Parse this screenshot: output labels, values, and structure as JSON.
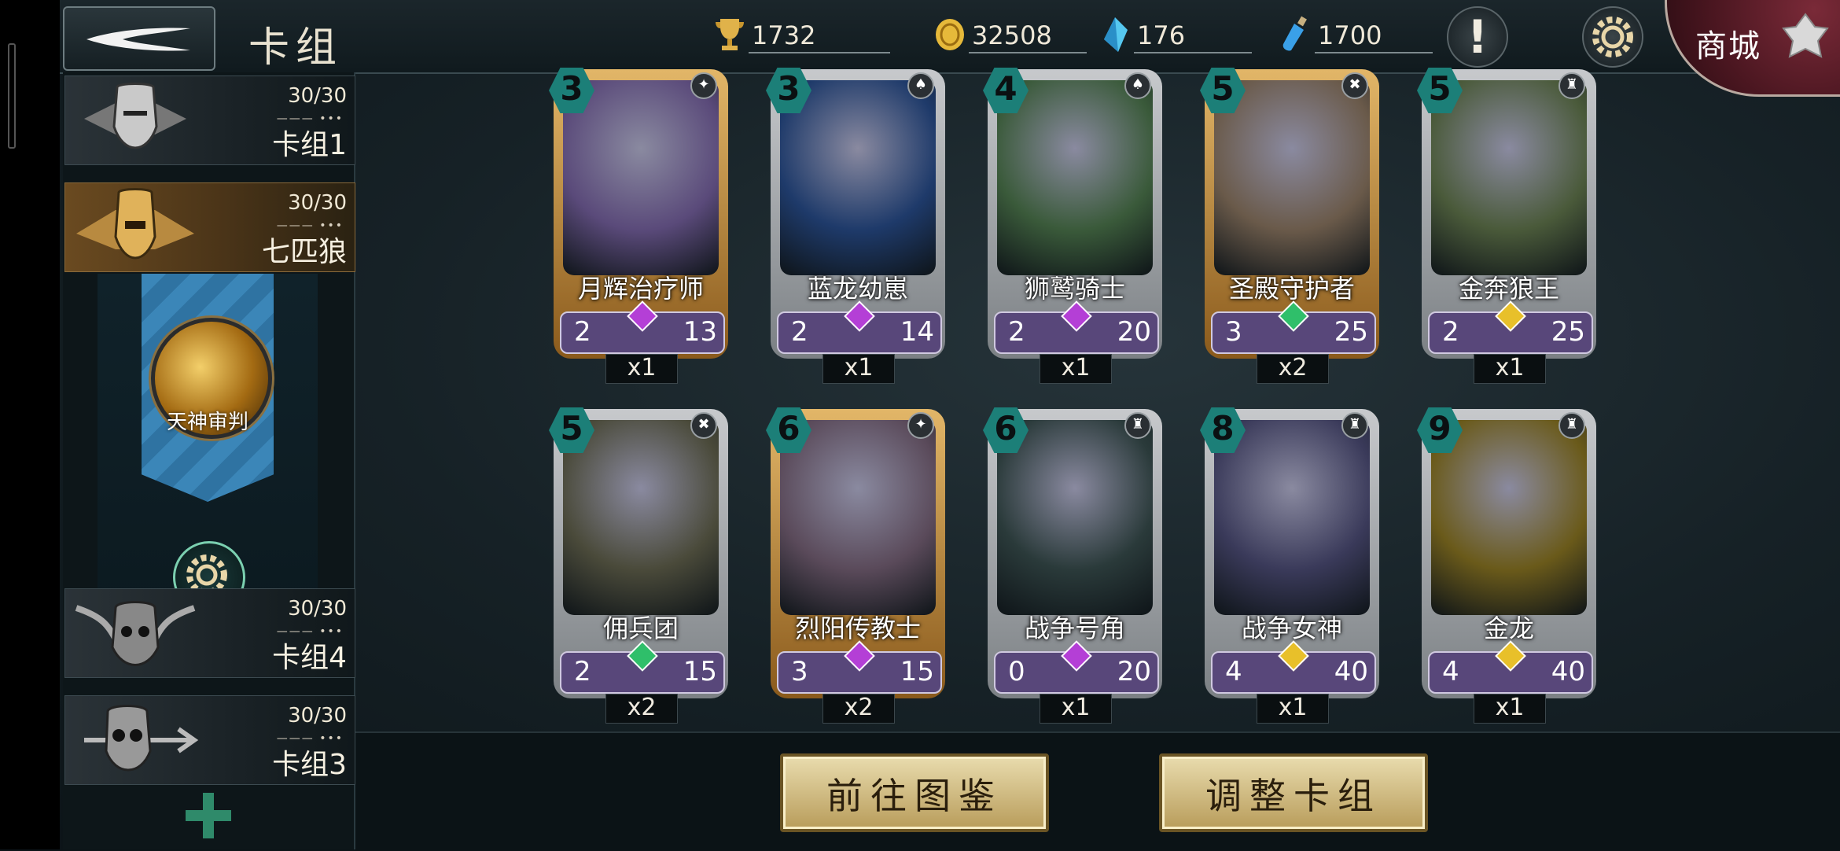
{
  "header": {
    "title": "卡组",
    "stats": [
      {
        "name": "trophy",
        "icon": "trophy-icon",
        "value": "1732"
      },
      {
        "name": "gold",
        "icon": "gold-coin-icon",
        "value": "32508"
      },
      {
        "name": "crystal",
        "icon": "crystal-icon",
        "value": "176"
      },
      {
        "name": "potion",
        "icon": "potion-icon",
        "value": "1700"
      }
    ],
    "notice_glyph": "!",
    "shop_label": "商城"
  },
  "decks": [
    {
      "count": "30/30",
      "name": "卡组1",
      "selected": false
    },
    {
      "count": "30/30",
      "name": "七匹狼",
      "selected": true
    },
    {
      "count": "30/30",
      "name": "卡组4",
      "selected": false
    },
    {
      "count": "30/30",
      "name": "卡组3",
      "selected": false
    }
  ],
  "hero": {
    "name": "天神审判"
  },
  "cards": [
    {
      "cost": "3",
      "name": "月辉治疗师",
      "atk": "2",
      "hp": "13",
      "qty": "x1",
      "gem": "#b43fd6"
    },
    {
      "cost": "3",
      "name": "蓝龙幼崽",
      "atk": "2",
      "hp": "14",
      "qty": "x1",
      "gem": "#b43fd6"
    },
    {
      "cost": "4",
      "name": "狮鹫骑士",
      "atk": "2",
      "hp": "20",
      "qty": "x1",
      "gem": "#b43fd6"
    },
    {
      "cost": "5",
      "name": "圣殿守护者",
      "atk": "3",
      "hp": "25",
      "qty": "x2",
      "gem": "#2fbf6a"
    },
    {
      "cost": "5",
      "name": "金奔狼王",
      "atk": "2",
      "hp": "25",
      "qty": "x1",
      "gem": "#e8c02a"
    },
    {
      "cost": "5",
      "name": "佣兵团",
      "atk": "2",
      "hp": "15",
      "qty": "x2",
      "gem": "#2fbf6a"
    },
    {
      "cost": "6",
      "name": "烈阳传教士",
      "atk": "3",
      "hp": "15",
      "qty": "x2",
      "gem": "#b43fd6"
    },
    {
      "cost": "6",
      "name": "战争号角",
      "atk": "0",
      "hp": "20",
      "qty": "x1",
      "gem": "#b43fd6"
    },
    {
      "cost": "8",
      "name": "战争女神",
      "atk": "4",
      "hp": "40",
      "qty": "x1",
      "gem": "#e8c02a"
    },
    {
      "cost": "9",
      "name": "金龙",
      "atk": "4",
      "hp": "40",
      "qty": "x1",
      "gem": "#e8c02a"
    }
  ],
  "buttons": {
    "codex": "前往图鉴",
    "adjust": "调整卡组"
  }
}
